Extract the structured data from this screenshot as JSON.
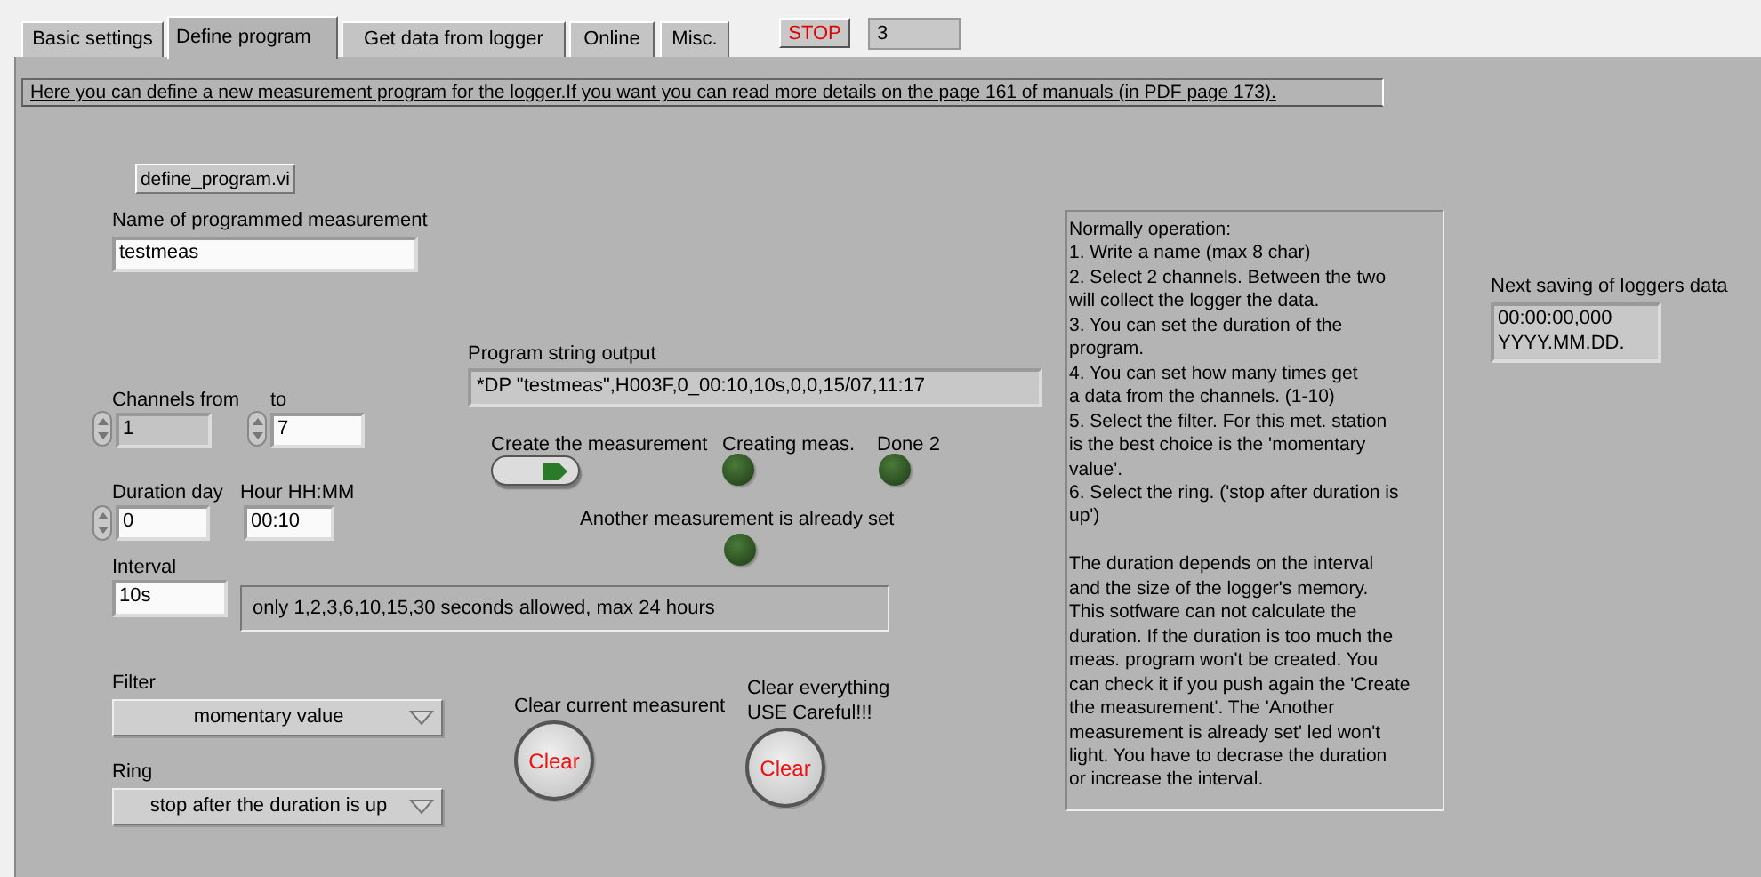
{
  "tabs": [
    {
      "label": "Basic settings",
      "selected": false
    },
    {
      "label": "Define program",
      "selected": true
    },
    {
      "label": "Get data from logger",
      "selected": false
    },
    {
      "label": "Online",
      "selected": false
    },
    {
      "label": "Misc.",
      "selected": false
    }
  ],
  "stop_button": "STOP",
  "counter": "3",
  "description": "Here you can define a new measurement program for the logger.If you want you can read more details on the  page 161 of manuals (in PDF page 173).",
  "vi_button": "define_program.vi",
  "name_field": {
    "label": "Name of programmed measurement",
    "value": "testmeas"
  },
  "channels_from": {
    "label": "Channels from",
    "value": "1",
    "disabled": true
  },
  "channels_to": {
    "label": "to",
    "value": "7",
    "disabled": false
  },
  "duration_day": {
    "label": "Duration day",
    "value": "0"
  },
  "hour": {
    "label": "Hour HH:MM",
    "value": "00:10"
  },
  "interval": {
    "label": "Interval",
    "value": "10s"
  },
  "interval_note": "only 1,2,3,6,10,15,30 seconds allowed, max 24 hours",
  "program_string": {
    "label": "Program string output",
    "value": "*DP \"testmeas\",H003F,0_00:10,10s,0,0,15/07,11:17"
  },
  "create_switch": {
    "label": "Create the measurement",
    "on": false
  },
  "leds": [
    {
      "label": "Creating meas.",
      "on": false
    },
    {
      "label": "Done 2",
      "on": false
    },
    {
      "label": "Another measurement is already set",
      "on": false
    }
  ],
  "filter": {
    "label": "Filter",
    "value": "momentary value"
  },
  "ring": {
    "label": "Ring",
    "value": "stop after the duration is up"
  },
  "clear_current": {
    "label": "Clear current measurent",
    "button": "Clear"
  },
  "clear_all": {
    "label": "Clear everything\nUSE Careful!!!",
    "button": "Clear"
  },
  "help": "Normally operation:\n1. Write a name (max 8 char)\n2. Select 2 channels. Between the two\nwill collect the logger the data.\n3. You can set the duration of the\nprogram.\n4. You can set how many times get\na data from the channels. (1-10)\n5. Select the filter. For this met. station\nis the best choice is the 'momentary\nvalue'.\n6. Select the ring. ('stop after duration is\nup')\n\nThe duration depends on the interval\nand the size of the logger's memory.\nThis sotfware can not calculate the\nduration. If the duration is too much the\nmeas. program won't be created. You\ncan check it if you push again the 'Create\nthe measurement'. The 'Another\nmeasurement is already set' led won't\nlight. You have to decrase the duration\nor increase the interval.",
  "next_saving": {
    "label": "Next saving of loggers data",
    "value": "00:00:00,000\nYYYY.MM.DD."
  }
}
